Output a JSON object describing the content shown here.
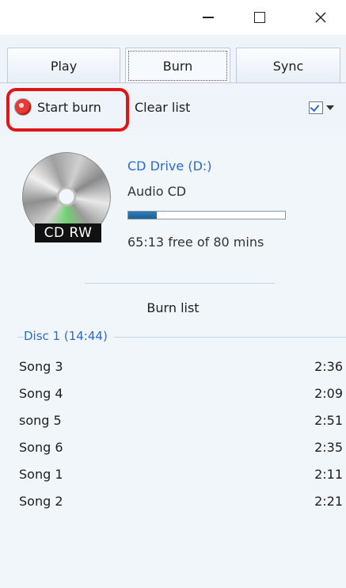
{
  "window": {
    "controls": [
      "minimize",
      "maximize",
      "close"
    ]
  },
  "tabs": [
    {
      "label": "Play"
    },
    {
      "label": "Burn",
      "selected": true
    },
    {
      "label": "Sync"
    }
  ],
  "toolbar": {
    "start_burn_label": "Start burn",
    "clear_list_label": "Clear list"
  },
  "drive": {
    "name": "CD Drive (D:)",
    "media_type": "Audio CD",
    "disc_label": "CD RW",
    "used_fraction": 0.18,
    "free_text": "65:13 free of 80 mins"
  },
  "burn_list": {
    "title": "Burn list",
    "disc_header": "Disc 1 (14:44)",
    "songs": [
      {
        "title": "Song 3",
        "duration": "2:36"
      },
      {
        "title": "Song 4",
        "duration": "2:09"
      },
      {
        "title": "song 5",
        "duration": "2:51"
      },
      {
        "title": "Song 6",
        "duration": "2:35"
      },
      {
        "title": "Song 1",
        "duration": "2:11"
      },
      {
        "title": "Song 2",
        "duration": "2:21"
      }
    ]
  },
  "colors": {
    "accent_blue": "#2a6bd1",
    "highlight_red": "#e01616",
    "pane_bg": "#eef4fa"
  }
}
